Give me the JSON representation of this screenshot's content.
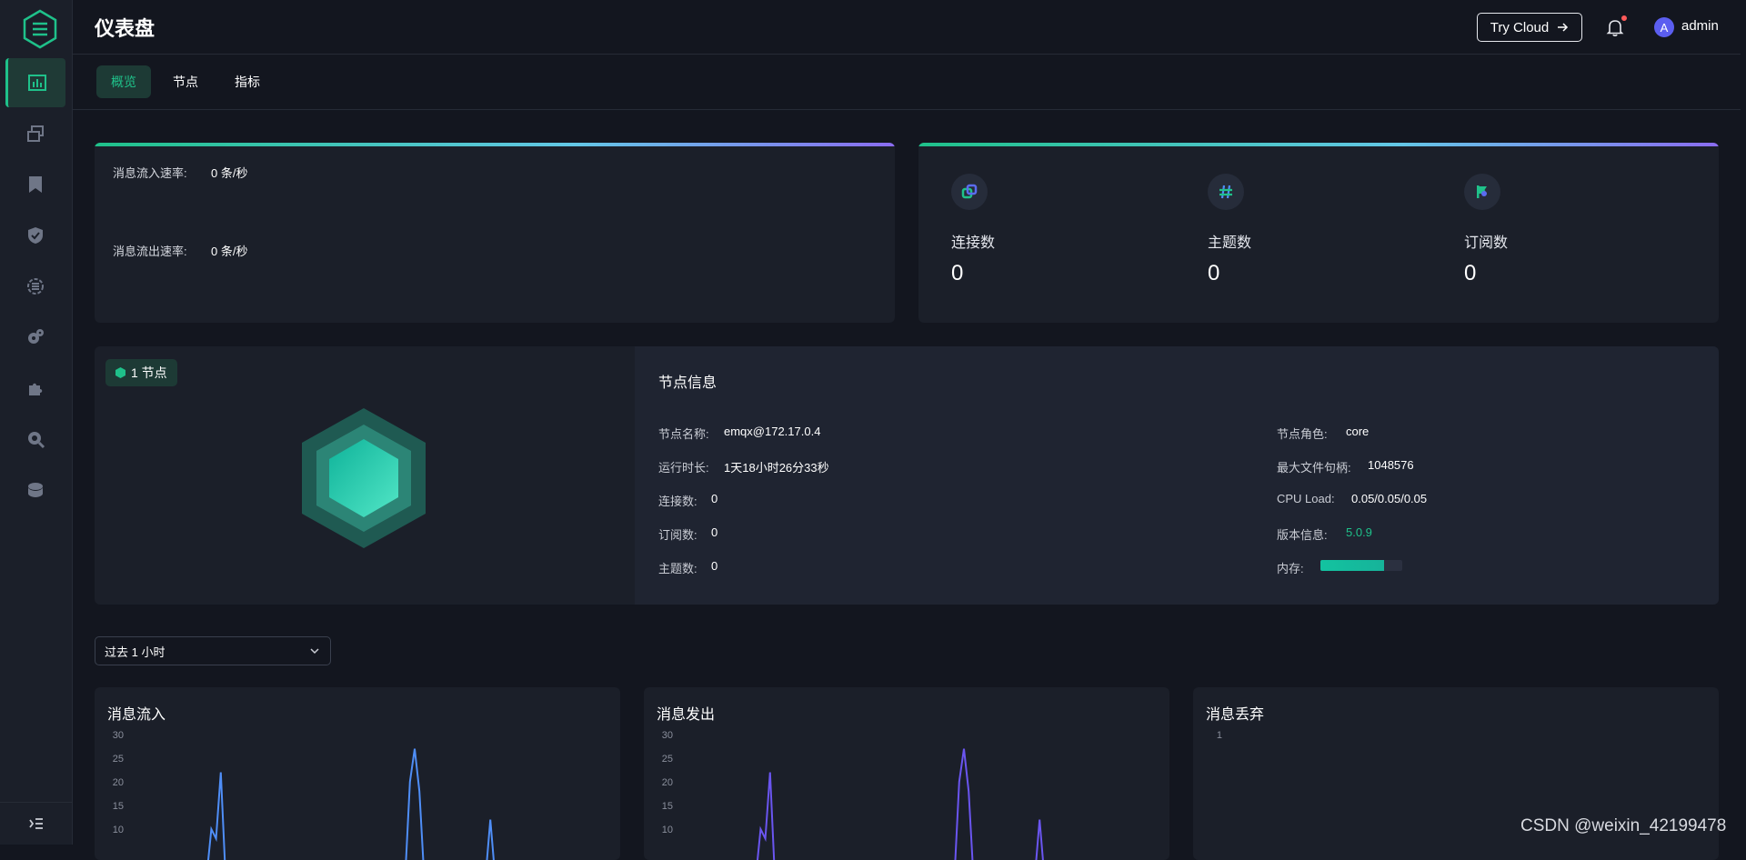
{
  "header": {
    "title": "仪表盘",
    "try_cloud": "Try Cloud",
    "avatar_letter": "A",
    "username": "admin"
  },
  "tabs": [
    {
      "label": "概览",
      "active": true
    },
    {
      "label": "节点",
      "active": false
    },
    {
      "label": "指标",
      "active": false
    }
  ],
  "rates": {
    "in_label": "消息流入速率:",
    "in_value": "0 条/秒",
    "out_label": "消息流出速率:",
    "out_value": "0 条/秒"
  },
  "stats": [
    {
      "label": "连接数",
      "value": "0",
      "icon": "link-icon"
    },
    {
      "label": "主题数",
      "value": "0",
      "icon": "hash-icon"
    },
    {
      "label": "订阅数",
      "value": "0",
      "icon": "flag-icon"
    }
  ],
  "node": {
    "badge": "1 节点",
    "info_title": "节点信息",
    "left": [
      {
        "label": "节点名称:",
        "value": "emqx@172.17.0.4"
      },
      {
        "label": "运行时长:",
        "value": "1天18小时26分33秒"
      },
      {
        "label": "连接数:",
        "value": "0"
      },
      {
        "label": "订阅数:",
        "value": "0"
      },
      {
        "label": "主题数:",
        "value": "0"
      }
    ],
    "right": [
      {
        "label": "节点角色:",
        "value": "core"
      },
      {
        "label": "最大文件句柄:",
        "value": "1048576"
      },
      {
        "label": "CPU Load:",
        "value": "0.05/0.05/0.05"
      },
      {
        "label": "版本信息:",
        "value": "5.0.9"
      },
      {
        "label": "内存:",
        "value": ""
      }
    ],
    "memory_fraction": 0.78,
    "version_color": "#1fc18a"
  },
  "time_range": {
    "selected": "过去 1 小时"
  },
  "charts": {
    "in_title": "消息流入",
    "out_title": "消息发出",
    "drop_title": "消息丢弃"
  },
  "chart_data": [
    {
      "type": "line",
      "title": "消息流入",
      "ylim": [
        0,
        30
      ],
      "yticks": [
        "30",
        "25",
        "20",
        "15",
        "10"
      ],
      "color": "#4f8ef7",
      "x": [
        0,
        0.16,
        0.17,
        0.18,
        0.19,
        0.2,
        0.21,
        0.22,
        0.58,
        0.59,
        0.6,
        0.61,
        0.62,
        0.75,
        0.76,
        0.77,
        1
      ],
      "values": [
        0,
        0,
        10,
        8,
        22,
        0,
        0,
        0,
        0,
        20,
        27,
        18,
        0,
        0,
        12,
        0,
        0
      ]
    },
    {
      "type": "line",
      "title": "消息发出",
      "ylim": [
        0,
        30
      ],
      "yticks": [
        "30",
        "25",
        "20",
        "15",
        "10"
      ],
      "color": "#6a55f0",
      "x": [
        0,
        0.16,
        0.17,
        0.18,
        0.19,
        0.2,
        0.21,
        0.22,
        0.58,
        0.59,
        0.6,
        0.61,
        0.62,
        0.75,
        0.76,
        0.77,
        1
      ],
      "values": [
        0,
        0,
        10,
        8,
        22,
        0,
        0,
        0,
        0,
        20,
        27,
        18,
        0,
        0,
        12,
        0,
        0
      ]
    },
    {
      "type": "line",
      "title": "消息丢弃",
      "yticks": [
        "1"
      ],
      "values": []
    }
  ],
  "watermark": "CSDN @weixin_42199478",
  "colors": {
    "accent": "#1fc18a",
    "bg": "#13161f",
    "card": "#1b1f29"
  }
}
